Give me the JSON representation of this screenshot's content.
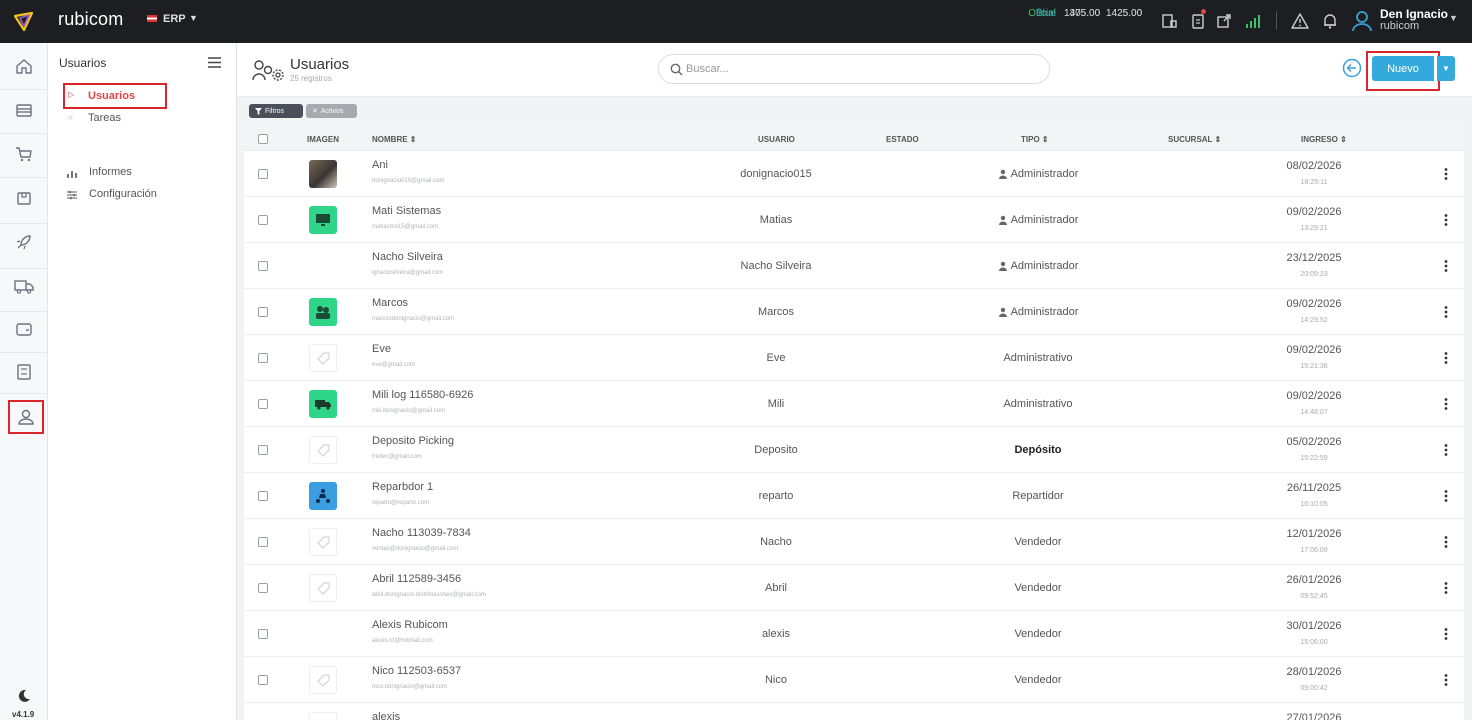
{
  "topbar": {
    "brand": "rubicom",
    "module": "ERP",
    "rates": [
      {
        "label": "Oficial",
        "v1": "1375.00",
        "v2": "1425.00"
      },
      {
        "label": "Blue",
        "v1": "1405.00",
        "v2": "1425.00"
      }
    ],
    "user_name": "Den Ignacio",
    "user_company": "rubicom",
    "colors": {
      "bg": "#1d1e22",
      "oficial": "#3fbf6a",
      "blue": "#3aa0d8",
      "accent": "#34a9db",
      "highlight": "#d9262c"
    }
  },
  "rail": {
    "icons": [
      "home-icon",
      "store-icon",
      "cart-icon",
      "box-icon",
      "rocket-icon",
      "truck-icon",
      "wallet-icon",
      "save-icon",
      "user-icon"
    ],
    "active": "user-icon",
    "version": "v4.1.9"
  },
  "submenu": {
    "title": "Usuarios",
    "items": [
      {
        "label": "Usuarios",
        "active": true
      },
      {
        "label": "Tareas",
        "active": false
      }
    ],
    "sections": [
      {
        "label": "Informes",
        "icon": "chart-icon"
      },
      {
        "label": "Configuración",
        "icon": "sliders-icon"
      }
    ]
  },
  "header": {
    "title": "Usuarios",
    "subtitle": "25 registros",
    "search_placeholder": "Buscar...",
    "new_label": "Nuevo"
  },
  "filters": {
    "filtros": "Filtros",
    "activos": "Activos"
  },
  "table": {
    "columns": {
      "imagen": "IMAGEN",
      "nombre": "NOMBRE",
      "usuario": "USUARIO",
      "estado": "ESTADO",
      "tipo": "TIPO",
      "sucursal": "SUCURSAL",
      "ingreso": "INGRESO"
    },
    "rows": [
      {
        "name": "Ani",
        "email": "donignacio015@gmail.com",
        "usuario": "donignacio015",
        "tipo": "Administrador",
        "admin": true,
        "date": "08/02/2026",
        "time": "18:25:11",
        "avatar": "photo"
      },
      {
        "name": "Mati Sistemas",
        "email": "matiasmo15@gmail.com",
        "usuario": "Matias",
        "tipo": "Administrador",
        "admin": true,
        "date": "09/02/2026",
        "time": "13:29:21",
        "avatar": "green-monitor"
      },
      {
        "name": "Nacho Silveira",
        "email": "ignaciosilveira@gmail.com",
        "usuario": "Nacho Silveira",
        "tipo": "Administrador",
        "admin": true,
        "date": "23/12/2025",
        "time": "20:09:23",
        "avatar": "none"
      },
      {
        "name": "Marcos",
        "email": "marcosdonignacio@gmail.com",
        "usuario": "Marcos",
        "tipo": "Administrador",
        "admin": true,
        "date": "09/02/2026",
        "time": "14:29:52",
        "avatar": "green-people"
      },
      {
        "name": "Eve",
        "email": "eve@gmail.com",
        "usuario": "Eve",
        "tipo": "Administrativo",
        "admin": false,
        "date": "09/02/2026",
        "time": "15:21:36",
        "avatar": "placeholder"
      },
      {
        "name": "Mili log 116580-6926",
        "email": "mili.donignacio@gmail.com",
        "usuario": "Mili",
        "tipo": "Administrativo",
        "admin": false,
        "date": "09/02/2026",
        "time": "14:48:07",
        "avatar": "green-truck"
      },
      {
        "name": "Deposito Picking",
        "email": "miden@gmail.com",
        "usuario": "Deposito",
        "tipo": "Depósito",
        "admin": false,
        "bold": true,
        "date": "05/02/2026",
        "time": "15:22:59",
        "avatar": "placeholder"
      },
      {
        "name": "Reparbdor 1",
        "email": "reparto@reparto.com",
        "usuario": "reparto",
        "tipo": "Repartidor",
        "admin": false,
        "date": "26/11/2025",
        "time": "16:10:05",
        "avatar": "blue-scooter"
      },
      {
        "name": "Nacho 113039-7834",
        "email": "ventas@donignacio@gmail.com",
        "usuario": "Nacho",
        "tipo": "Vendedor",
        "admin": false,
        "date": "12/01/2026",
        "time": "17:06:09",
        "avatar": "placeholder"
      },
      {
        "name": "Abril 112589-3456",
        "email": "abril.donignacio.distribuciones@gmail.com",
        "usuario": "Abril",
        "tipo": "Vendedor",
        "admin": false,
        "date": "26/01/2026",
        "time": "09:52:45",
        "avatar": "placeholder"
      },
      {
        "name": "Alexis Rubicom",
        "email": "alexis.rd@hotmail.com",
        "usuario": "alexis",
        "tipo": "Vendedor",
        "admin": false,
        "date": "30/01/2026",
        "time": "15:06:00",
        "avatar": "none"
      },
      {
        "name": "Nico 112503-6537",
        "email": "nico.donignacio@gmail.com",
        "usuario": "Nico",
        "tipo": "Vendedor",
        "admin": false,
        "date": "28/01/2026",
        "time": "09:00:42",
        "avatar": "placeholder"
      },
      {
        "name": "alexis",
        "email": "",
        "usuario": "",
        "tipo": "",
        "admin": false,
        "date": "27/01/2026",
        "time": "",
        "avatar": "placeholder"
      }
    ]
  }
}
